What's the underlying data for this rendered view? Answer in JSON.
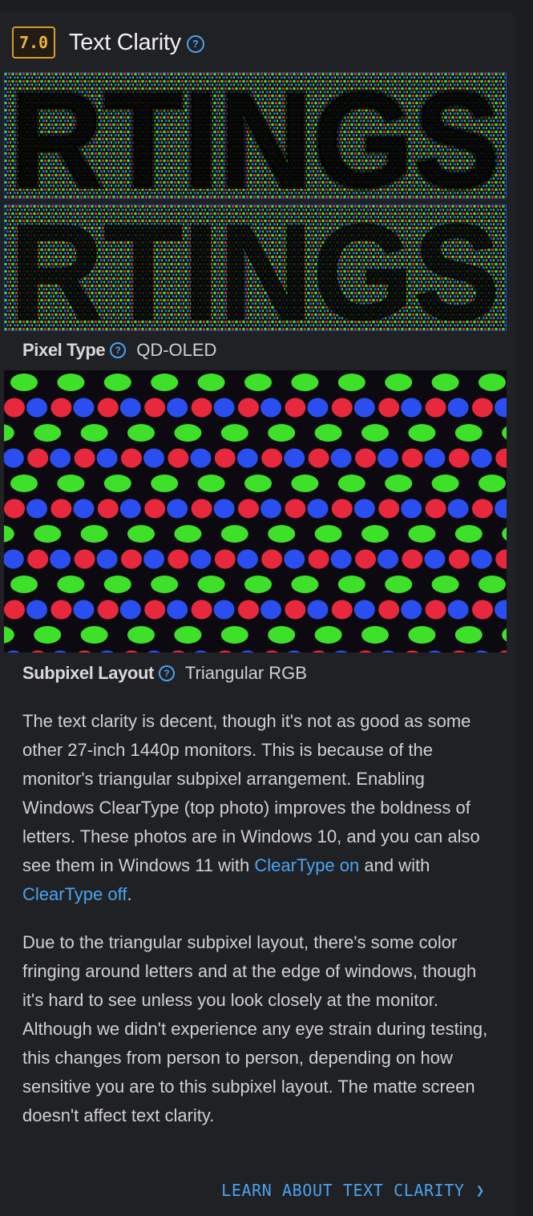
{
  "section": {
    "score": "7.0",
    "title": "Text Clarity"
  },
  "photos": {
    "cleartype_text": "RTINGS"
  },
  "specs": [
    {
      "label": "Pixel Type",
      "value": "QD-OLED"
    },
    {
      "label": "Subpixel Layout",
      "value": "Triangular RGB"
    }
  ],
  "paragraph1": {
    "text_before": "The text clarity is decent, though it's not as good as some other 27-inch 1440p monitors. This is because of the monitor's triangular subpixel arrangement. Enabling Windows ClearType (top photo) improves the boldness of letters. These photos are in Windows 10, and you can also see them in Windows 11 with ",
    "link1": "ClearType on",
    "text_mid": " and with ",
    "link2": "ClearType off",
    "text_after": "."
  },
  "paragraph2": "Due to the triangular subpixel layout, there's some color fringing around letters and at the edge of windows, though it's hard to see unless you look closely at the monitor. Although we didn't experience any eye strain during testing, this changes from person to person, depending on how sensitive you are to this subpixel layout. The matte screen doesn't affect text clarity.",
  "learn_more": "LEARN ABOUT TEXT CLARITY",
  "colors": {
    "accent": "#4aa3f0",
    "score_border": "#d89a2a",
    "background": "#202124",
    "subpixel_red": "#e8283c",
    "subpixel_green": "#3ee02a",
    "subpixel_blue": "#2a4ef0"
  }
}
